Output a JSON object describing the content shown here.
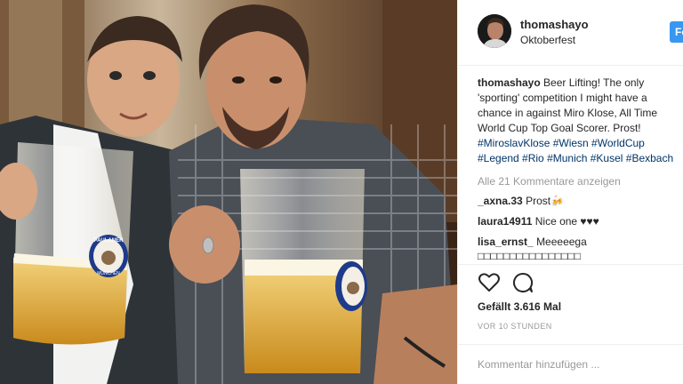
{
  "post": {
    "username": "thomashayo",
    "location": "Oktoberfest",
    "follow_label": "Folgen",
    "caption_user": "thomashayo",
    "caption_text": "Beer Lifting! The only 'sporting' competition I might have a chance in against Miro Klose, All Time World Cup Top Goal Scorer. Prost!",
    "hashtags": "#MiroslavKlose #Wiesn #WorldCup #Legend #Rio #Munich #Kusel #Bexbach",
    "view_all": "Alle 21 Kommentare anzeigen",
    "comments": [
      {
        "user": "_axna.33",
        "text": "Prost🍻"
      },
      {
        "user": "laura14911",
        "text": "Nice one ♥♥♥"
      },
      {
        "user": "lisa_ernst_",
        "text": "Meeeeega □□□□□□□□□□□□□□□□"
      }
    ],
    "likes": "Gefällt 3.616 Mal",
    "time_ago": "VOR 10 STUNDEN",
    "comment_placeholder": "Kommentar hinzufügen ..."
  },
  "photo": {
    "mug_brand": "PAULANER",
    "mug_city": "MÜNCHEN"
  },
  "icons": {
    "like": "heart-icon",
    "comment": "speech-bubble-icon"
  },
  "colors": {
    "follow_button": "#3897f0",
    "hashtag": "#003569",
    "muted": "#999999"
  }
}
